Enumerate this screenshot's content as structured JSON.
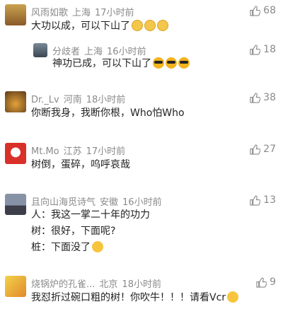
{
  "comments": [
    {
      "user": "风雨如歌",
      "region": "上海",
      "time": "17小时前",
      "likes": "68",
      "lines": [
        "大功以成，可以下山了"
      ],
      "emoji": "cat-emoji"
    },
    {
      "user": "分歧者",
      "region": "上海",
      "time": "16小时前",
      "likes": "18",
      "lines": [
        "神功已成，可以下山了"
      ],
      "emoji": "sunglasses-emoji"
    },
    {
      "user": "Dr._Lv",
      "region": "河南",
      "time": "18小时前",
      "likes": "38",
      "lines": [
        "你断我身，我断你根，Who怕Who"
      ]
    },
    {
      "user": "Mt.Mo",
      "region": "江苏",
      "time": "17小时前",
      "likes": "27",
      "lines": [
        "树倒，蛋碎，呜呼哀哉"
      ]
    },
    {
      "user": "且向山海觅诗气",
      "region": "安徽",
      "time": "16小时前",
      "likes": "13",
      "lines": [
        "人：我这一掌二十年的功力",
        "树：很好，下面呢?",
        "桩：下面没了"
      ],
      "emoji": "facepalm-emoji"
    },
    {
      "user": "烧锅炉的孔雀...",
      "region": "北京",
      "time": "18小时前",
      "likes": "9",
      "lines": [
        "我怼折过碗口粗的树！你吹牛！！！请看Vcr"
      ],
      "emoji": "smile-emoji"
    }
  ]
}
